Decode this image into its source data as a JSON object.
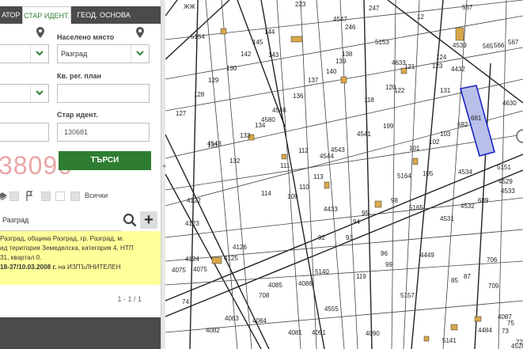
{
  "tabs": {
    "tab1": "АТОР",
    "tab2": "СТАР ИДЕНТ.",
    "tab3": "ГЕОД. ОСНОВА"
  },
  "form": {
    "settlement_label": "Населено място",
    "settlement_value": "Разград",
    "cadastral_label": "Кв. рег. план",
    "cadastral_value": "",
    "old_ident_label": "Стар идент.",
    "old_ident_value": "130681",
    "search_label": "ТЪРСИ"
  },
  "watermark": "38090",
  "layers": {
    "all_label": "Всички"
  },
  "results": {
    "search_value": "Разград",
    "line1": "Разград, община Разград, гр. Разград, м.",
    "line2": "ид територия Земеделска, категория 4, НТП",
    "line3": "31, квартал 0.",
    "line4_bold": "18-37/10.03.2008 г.",
    "line4_rest": " на ИЗПЪЛНИТЕЛЕН",
    "pager": "1 - 1 / 1"
  },
  "map": {
    "parcels": [
      "223",
      "4547",
      "247",
      "12",
      "557",
      "5154",
      "144",
      "246",
      "5153",
      "4539",
      "565",
      "566",
      "567",
      "145",
      "142",
      "138",
      "4633",
      "121",
      "123",
      "124",
      "4432",
      "143",
      "130",
      "139",
      "140",
      "137",
      "122",
      "131",
      "4548",
      "4630",
      "127",
      "128",
      "129",
      "136",
      "118",
      "120",
      "4546",
      "4580",
      "134",
      "133",
      "199",
      "682",
      "681",
      "131",
      "132",
      "111",
      "112",
      "4544",
      "4543",
      "4541",
      "101",
      "102",
      "103",
      "4534",
      "5151",
      "114",
      "110",
      "109",
      "113",
      "5164",
      "105",
      "4529",
      "4533",
      "4122",
      "4123",
      "4433",
      "95",
      "98",
      "5165",
      "4531",
      "4532",
      "689",
      "4124",
      "4125",
      "92",
      "93",
      "94",
      "4126",
      "96",
      "4449",
      "4075",
      "4075",
      "5140",
      "99",
      "119",
      "4085",
      "4086",
      "5157",
      "85",
      "87",
      "706",
      "709",
      "708",
      "4084",
      "4555",
      "4083",
      "4082",
      "4081",
      "4091",
      "4090",
      "4087",
      "4484",
      "73",
      "74",
      "75",
      "5141",
      "72",
      "4528",
      "71",
      "4531"
    ],
    "selected_parcel": "681",
    "road_label": "ЖЖ"
  },
  "colors": {
    "accent_green": "#2e7d32",
    "selection_fill": "#b8bfe8",
    "selection_stroke": "#1a24c4",
    "result_bg": "#ffff99",
    "dark_bar": "#4b4b4b"
  }
}
